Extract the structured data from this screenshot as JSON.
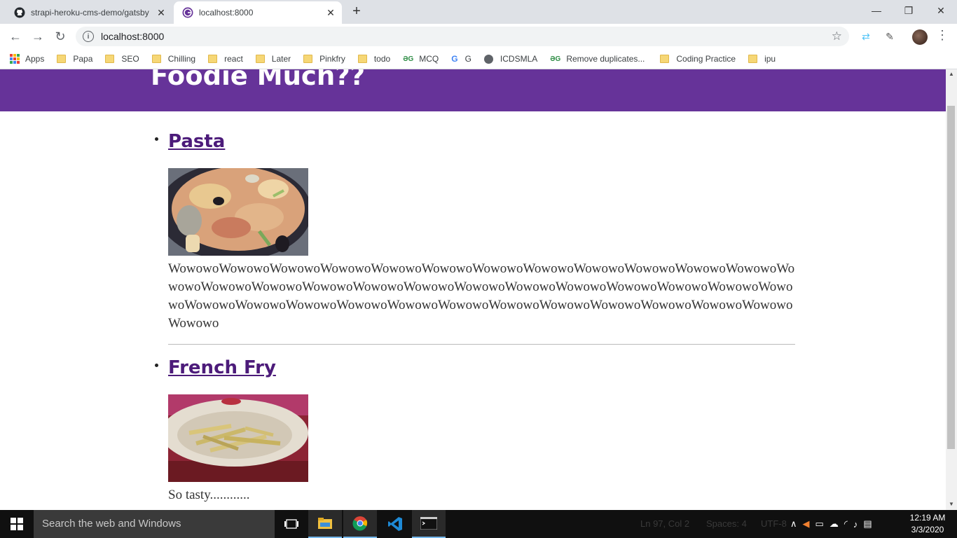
{
  "browser": {
    "tabs": [
      {
        "title": "strapi-heroku-cms-demo/gatsby",
        "favicon": "github-icon"
      },
      {
        "title": "localhost:8000",
        "favicon": "gatsby-icon"
      }
    ],
    "url": "localhost:8000",
    "bookmarks": [
      {
        "label": "Apps",
        "icon": "apps-grid-icon"
      },
      {
        "label": "Papa",
        "icon": "folder-icon"
      },
      {
        "label": "SEO",
        "icon": "folder-icon"
      },
      {
        "label": "Chilling",
        "icon": "folder-icon"
      },
      {
        "label": "react",
        "icon": "folder-icon"
      },
      {
        "label": "Later",
        "icon": "folder-icon"
      },
      {
        "label": "Pinkfry",
        "icon": "folder-icon"
      },
      {
        "label": "todo",
        "icon": "folder-icon"
      },
      {
        "label": "MCQ",
        "icon": "geeksforgeeks-icon"
      },
      {
        "label": "G",
        "icon": "google-icon"
      },
      {
        "label": "ICDSMLA",
        "icon": "globe-icon"
      },
      {
        "label": "Remove duplicates...",
        "icon": "geeksforgeeks-icon"
      },
      {
        "label": "Coding Practice",
        "icon": "folder-icon"
      },
      {
        "label": "ipu",
        "icon": "folder-icon"
      }
    ]
  },
  "page": {
    "site_title": "Foodie Much??",
    "header_color": "#663399",
    "posts": [
      {
        "title": "Pasta",
        "image": "pasta-photo",
        "text": "WowowoWowowoWowowoWowowoWowowoWowowoWowowoWowowoWowowoWowowoWowowoWowowoWowowoWowowoWowowoWowowoWowowoWowowoWowowoWowowoWowowoWowowoWowowoWowowoWowowoWowowoWowowoWowowoWowowoWowowoWowowoWowowoWowowoWowowoWowowoWowowoWowowoWowowo"
      },
      {
        "title": "French Fry",
        "image": "french-fries-photo",
        "text": "So tasty............"
      }
    ]
  },
  "taskbar": {
    "search_placeholder": "Search the web and Windows",
    "background_status": [
      "Ln 97, Col 2",
      "Spaces: 4",
      "UTF-8"
    ],
    "time": "12:19 AM",
    "date": "3/3/2020"
  }
}
